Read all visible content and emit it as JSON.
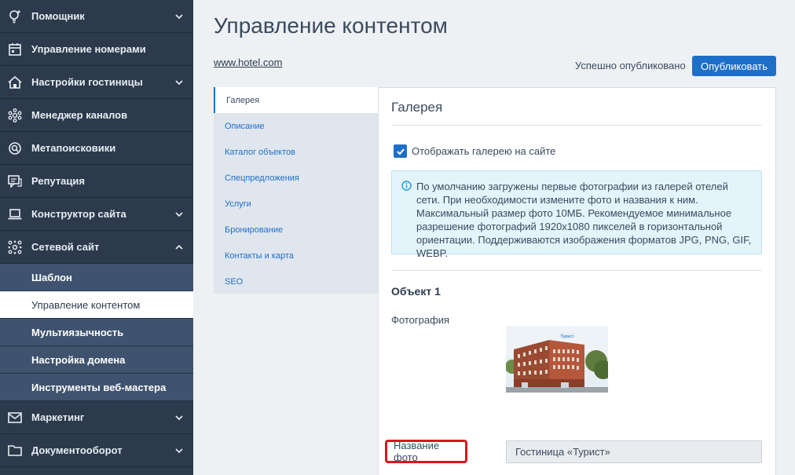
{
  "sidebar": {
    "items": [
      {
        "label": "Помощник",
        "icon": "lightbulb-icon",
        "has_chevron": true
      },
      {
        "label": "Управление номерами",
        "icon": "calendar-icon",
        "has_chevron": false
      },
      {
        "label": "Настройки гостиницы",
        "icon": "home-icon",
        "has_chevron": true
      },
      {
        "label": "Менеджер каналов",
        "icon": "network-icon",
        "has_chevron": false
      },
      {
        "label": "Метапоисковики",
        "icon": "search-icon",
        "has_chevron": false
      },
      {
        "label": "Репутация",
        "icon": "comment-icon",
        "has_chevron": false
      },
      {
        "label": "Конструктор сайта",
        "icon": "laptop-icon",
        "has_chevron": true
      },
      {
        "label": "Сетевой сайт",
        "icon": "sitemap-icon",
        "has_chevron": true,
        "expanded": true
      }
    ],
    "sub_items": [
      {
        "label": "Шаблон"
      },
      {
        "label": "Управление контентом",
        "active": true
      },
      {
        "label": "Мультиязычность"
      },
      {
        "label": "Настройка домена"
      },
      {
        "label": "Инструменты веб-мастера"
      }
    ],
    "bottom_items": [
      {
        "label": "Маркетинг",
        "icon": "mail-icon",
        "has_chevron": true
      },
      {
        "label": "Документооборот",
        "icon": "folder-icon",
        "has_chevron": true
      }
    ]
  },
  "header": {
    "title": "Управление контентом",
    "site_link": "www.hotel.com",
    "status": "Успешно опубликовано",
    "publish_label": "Опубликовать"
  },
  "tabs": [
    {
      "label": "Галерея",
      "active": true
    },
    {
      "label": "Описание"
    },
    {
      "label": "Каталог объектов"
    },
    {
      "label": "Спецпредложения"
    },
    {
      "label": "Услуги"
    },
    {
      "label": "Бронирование"
    },
    {
      "label": "Контакты и карта"
    },
    {
      "label": "SEO"
    }
  ],
  "panel": {
    "title": "Галерея",
    "show_gallery_label": "Отображать галерею на сайте",
    "show_gallery_checked": true,
    "info_text": "По умолчанию загружены первые фотографии из галерей отелей сети. При необходимости измените фото и названия к ним. Максимальный размер фото 10МБ. Рекомендуемое минимальное разрешение фотографий 1920x1080 пикселей в горизонтальной ориентации. Поддерживаются изображения форматов JPG, PNG, GIF, WEBP.",
    "object_title": "Объект 1",
    "photo_label": "Фотография",
    "photo_sign": "Турист",
    "photo_name_label": "Название фото",
    "photo_name_value": "Гостиница «Турист»"
  },
  "colors": {
    "sidebar_bg": "#2c3a4c",
    "sub_bg": "#3f536e",
    "accent": "#1e6fc8",
    "highlight": "#e0141e"
  }
}
